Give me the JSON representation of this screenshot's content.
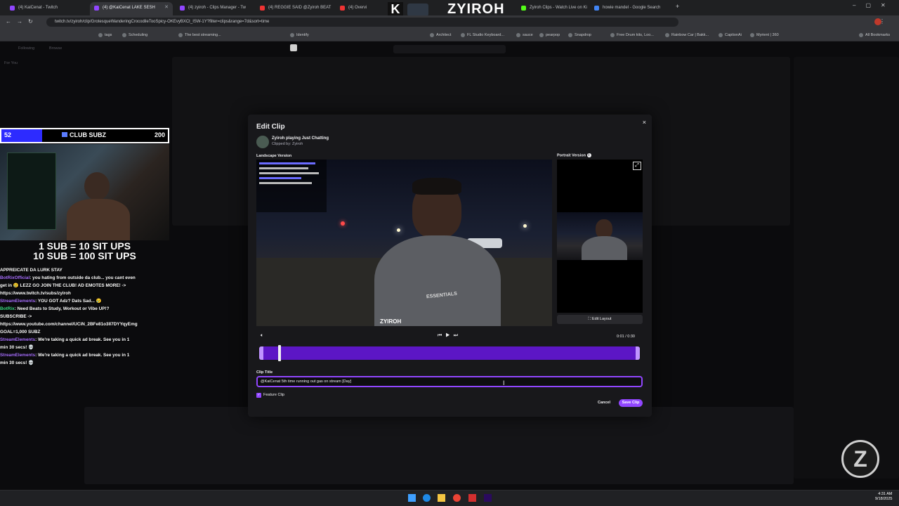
{
  "browser": {
    "tabs": [
      {
        "label": "(4) KaiCenat - Twitch",
        "active": false
      },
      {
        "label": "(4) @KaiCenat LAKE SESH",
        "active": true
      },
      {
        "label": "(4) zyiroh - Clips Manager - Tw",
        "active": false
      },
      {
        "label": "(4) REGGIE SAID @Zyiroh BEAT",
        "active": false
      },
      {
        "label": "(4) Overvi",
        "active": false
      },
      {
        "label": "Zyiroh Clips - Watch Live on Ki",
        "active": false
      },
      {
        "label": "howie mandel - Google Search",
        "active": false
      }
    ],
    "url": "twitch.tv/zyiroh/clip/GrotesqueWanderingCrocodileTooSpicy-OKEvyBXCt_ISW-1Y?filter=clips&range=7d&sort=time",
    "bookmarks": [
      "Scheduling",
      "The best streaming...",
      "Identify",
      "Architect",
      "FL Studio Keyboard...",
      "sauce",
      "pearpop",
      "Snapdrop",
      "Free Drum kits, Loo...",
      "Rainbow Car | Bakk...",
      "CaptionAi",
      "Myrient | 360"
    ],
    "all_bookmarks": "All Bookmarks",
    "tag_label": "tags"
  },
  "brand_overlay": {
    "logo_letter": "K",
    "name": "ZYIROH"
  },
  "twitch_bg": {
    "nav_following": "Following",
    "nav_browse": "Browse",
    "for_you": "For You"
  },
  "modal": {
    "title": "Edit Clip",
    "close": "×",
    "channel_line": "Zyiroh playing Just Chatting",
    "clipped_by": "Clipped by: Zyiroh",
    "landscape_label": "Landscape Version",
    "portrait_label": "Portrait Version",
    "edit_layout": "Edit Layout",
    "time": "0:01 / 0:30",
    "clip_title_label": "Clip Title",
    "clip_title_value": "@KaiCenat 5th time running out gas on stream [Day]",
    "feature_clip": "Feature Clip",
    "cancel": "Cancel",
    "save": "Save Clip",
    "video_watermark": "ZYIROH",
    "shirt_text": "ESSENTIALS",
    "progress": 0.04
  },
  "stream_overlay": {
    "sub_current": "52",
    "sub_label": "CLUB SUBZ",
    "sub_goal": "200",
    "promo_line1": "1 SUB = 10 SIT UPS",
    "promo_line2": "10 SUB = 100 SIT UPS",
    "chat": [
      {
        "user": "",
        "text": "APPREICATE DA LURK STAY"
      },
      {
        "user": "BotRixOfficial",
        "text": ": you hating from outside da club... you cant even"
      },
      {
        "user": "",
        "text": "get in 😢 LEZZ GO JOIN THE CLUB! AD EMOTES MORE! ->"
      },
      {
        "user": "",
        "text": "https://www.twitch.tv/subs/zyiroh"
      },
      {
        "user": "StreamElements",
        "text": ": YOU GOT Adz? Dats Sad... 😢"
      },
      {
        "user": "BotRix",
        "text": ": Need Beats to Study, Workout or Vibe UP!?"
      },
      {
        "user": "",
        "text": "SUBSCRIBE ->"
      },
      {
        "user": "",
        "text": "https://www.youtube.com/channel/UCiN_2BFe81o3II7DYYqyEmg"
      },
      {
        "user": "",
        "text": "GOAL=1,000 SUBZ"
      },
      {
        "user": "StreamElements",
        "text": ": We're taking a quick ad break. See you in 1"
      },
      {
        "user": "",
        "text": "min 30 secs! 💀"
      },
      {
        "user": "StreamElements",
        "text": ": We're taking a quick ad break. See you in 1"
      },
      {
        "user": "",
        "text": "min 30 secs! 💀"
      }
    ]
  },
  "taskbar": {
    "time": "4:31 AM",
    "date": "9/18/2025"
  },
  "colors": {
    "accent": "#9146ff",
    "bg": "#0e0e10",
    "modal": "#18181b"
  }
}
